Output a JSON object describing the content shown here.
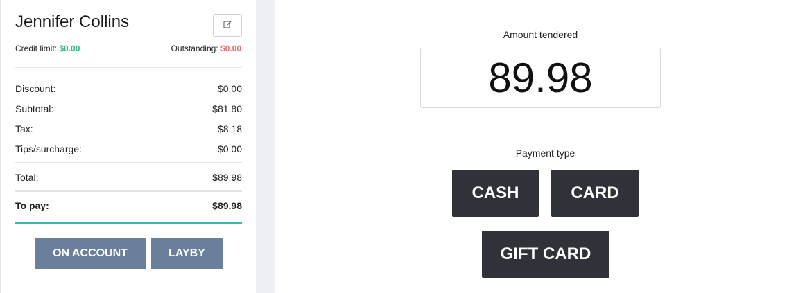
{
  "customer": {
    "name": "Jennifer Collins",
    "credit_limit_label": "Credit limit:",
    "credit_limit_value": "$0.00",
    "outstanding_label": "Outstanding:",
    "outstanding_value": "$0.00"
  },
  "summary": {
    "discount_label": "Discount:",
    "discount_value": "$0.00",
    "subtotal_label": "Subtotal:",
    "subtotal_value": "$81.80",
    "tax_label": "Tax:",
    "tax_value": "$8.18",
    "tips_label": "Tips/surcharge:",
    "tips_value": "$0.00",
    "total_label": "Total:",
    "total_value": "$89.98",
    "topay_label": "To pay:",
    "topay_value": "$89.98"
  },
  "actions": {
    "on_account": "ON ACCOUNT",
    "layby": "LAYBY"
  },
  "payment": {
    "amount_label": "Amount tendered",
    "amount_value": "89.98",
    "type_label": "Payment type",
    "cash": "CASH",
    "card": "CARD",
    "gift_card": "GIFT CARD"
  },
  "icons": {
    "edit": "edit-icon"
  },
  "colors": {
    "positive": "#2ebd7a",
    "negative": "#e07272",
    "accent_line": "#3cb6b8",
    "secondary_button": "#6a7f9c",
    "primary_button": "#2f3238"
  }
}
